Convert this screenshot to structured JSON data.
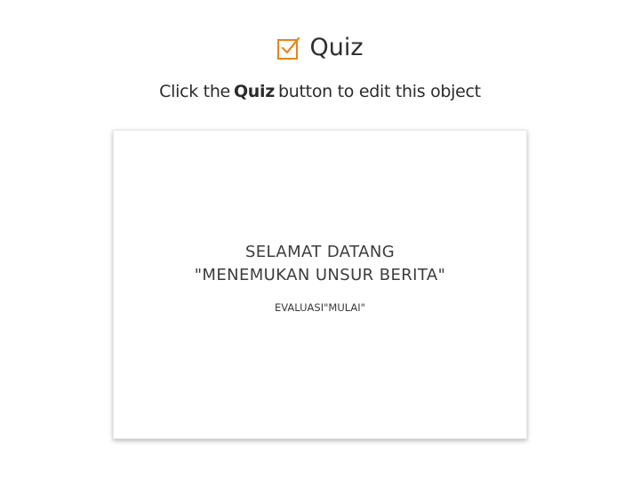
{
  "header": {
    "title": "Quiz",
    "icon": "checkbox-icon",
    "icon_color": "#e8851e"
  },
  "instruction": {
    "prefix": "Click the",
    "emphasis": "Quiz",
    "suffix": "button to edit this object"
  },
  "preview": {
    "line1": "SELAMAT DATANG",
    "line2": "\"MENEMUKAN UNSUR BERITA\"",
    "line3": "EVALUASI\"MULAI\""
  }
}
